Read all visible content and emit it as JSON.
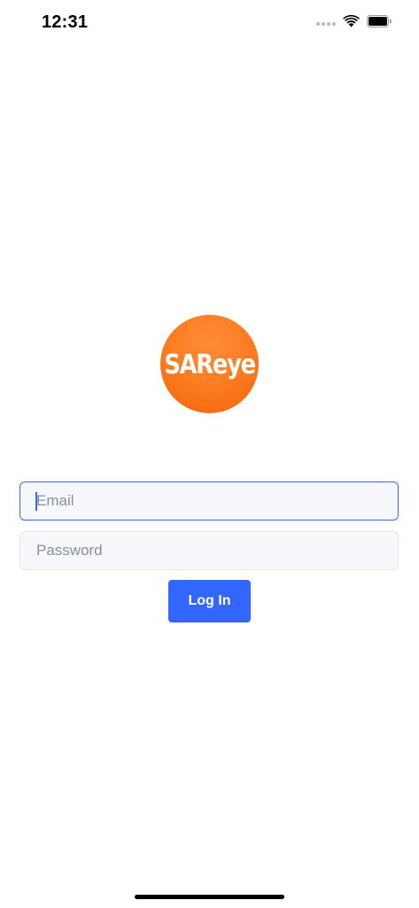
{
  "status_bar": {
    "time": "12:31",
    "signal_icon": "cellular-signal-icon",
    "wifi_icon": "wifi-icon",
    "battery_icon": "battery-icon"
  },
  "logo": {
    "text": "SAReye",
    "color": "#fb7a1e"
  },
  "form": {
    "email_placeholder": "Email",
    "email_value": "",
    "password_placeholder": "Password",
    "password_value": "",
    "login_label": "Log In"
  },
  "colors": {
    "accent": "#3366ff",
    "brand": "#fb7a1e",
    "focus_border": "#3b66f5"
  }
}
